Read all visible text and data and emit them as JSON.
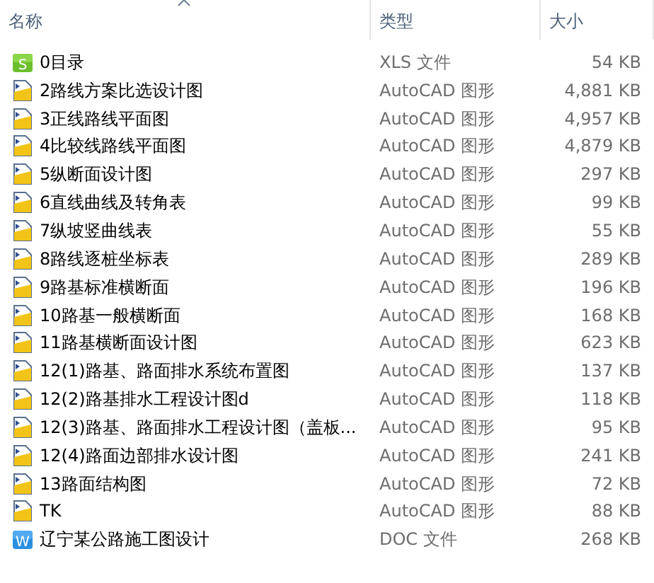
{
  "columns": [
    {
      "label": "名称",
      "sorted": true
    },
    {
      "label": "类型",
      "sorted": false
    },
    {
      "label": "大小",
      "sorted": false
    }
  ],
  "files": [
    {
      "kind": "xls",
      "icon_letter": "S",
      "name": "0目录",
      "type": "XLS 文件",
      "size": "54 KB"
    },
    {
      "kind": "dwg",
      "name": "2路线方案比选设计图",
      "type": "AutoCAD 图形",
      "size": "4,881 KB"
    },
    {
      "kind": "dwg",
      "name": "3正线路线平面图",
      "type": "AutoCAD 图形",
      "size": "4,957 KB"
    },
    {
      "kind": "dwg",
      "name": "4比较线路线平面图",
      "type": "AutoCAD 图形",
      "size": "4,879 KB"
    },
    {
      "kind": "dwg",
      "name": "5纵断面设计图",
      "type": "AutoCAD 图形",
      "size": "297 KB"
    },
    {
      "kind": "dwg",
      "name": "6直线曲线及转角表",
      "type": "AutoCAD 图形",
      "size": "99 KB"
    },
    {
      "kind": "dwg",
      "name": "7纵坡竖曲线表",
      "type": "AutoCAD 图形",
      "size": "55 KB"
    },
    {
      "kind": "dwg",
      "name": "8路线逐桩坐标表",
      "type": "AutoCAD 图形",
      "size": "289 KB"
    },
    {
      "kind": "dwg",
      "name": "9路基标准横断面",
      "type": "AutoCAD 图形",
      "size": "196 KB"
    },
    {
      "kind": "dwg",
      "name": "10路基一般横断面",
      "type": "AutoCAD 图形",
      "size": "168 KB"
    },
    {
      "kind": "dwg",
      "name": "11路基横断面设计图",
      "type": "AutoCAD 图形",
      "size": "623 KB"
    },
    {
      "kind": "dwg",
      "name": "12(1)路基、路面排水系统布置图",
      "type": "AutoCAD 图形",
      "size": "137 KB"
    },
    {
      "kind": "dwg",
      "name": "12(2)路基排水工程设计图d",
      "type": "AutoCAD 图形",
      "size": "118 KB"
    },
    {
      "kind": "dwg",
      "name": "12(3)路基、路面排水工程设计图（盖板...",
      "type": "AutoCAD 图形",
      "size": "95 KB"
    },
    {
      "kind": "dwg",
      "name": "12(4)路面边部排水设计图",
      "type": "AutoCAD 图形",
      "size": "241 KB"
    },
    {
      "kind": "dwg",
      "name": "13路面结构图",
      "type": "AutoCAD 图形",
      "size": "72 KB"
    },
    {
      "kind": "dwg",
      "name": "TK",
      "type": "AutoCAD 图形",
      "size": "88 KB"
    },
    {
      "kind": "doc",
      "icon_letter": "W",
      "name": "辽宁某公路施工图设计",
      "type": "DOC 文件",
      "size": "268 KB"
    }
  ]
}
